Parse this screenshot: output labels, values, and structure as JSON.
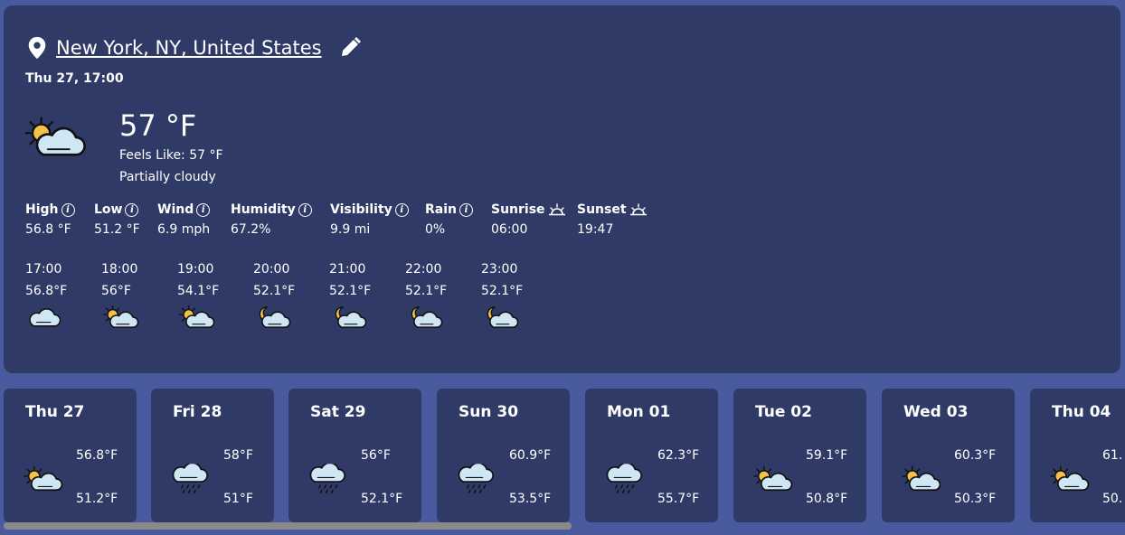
{
  "location": {
    "name": "New York, NY, United States"
  },
  "datetime": "Thu 27, 17:00",
  "current": {
    "temperature": "57 °F",
    "feels_like": "Feels Like: 57 °F",
    "condition": "Partially cloudy",
    "icon": "partly-cloudy-day-icon"
  },
  "stats": [
    {
      "label": "High",
      "value": "56.8 °F",
      "icon": "info-icon"
    },
    {
      "label": "Low",
      "value": "51.2 °F",
      "icon": "info-icon"
    },
    {
      "label": "Wind",
      "value": "6.9 mph",
      "icon": "info-icon"
    },
    {
      "label": "Humidity",
      "value": "67.2%",
      "icon": "info-icon"
    },
    {
      "label": "Visibility",
      "value": "9.9 mi",
      "icon": "info-icon"
    },
    {
      "label": "Rain",
      "value": "0%",
      "icon": "info-icon"
    },
    {
      "label": "Sunrise",
      "value": "06:00",
      "icon": "sunrise-icon"
    },
    {
      "label": "Sunset",
      "value": "19:47",
      "icon": "sunset-icon"
    }
  ],
  "hourly": [
    {
      "time": "17:00",
      "temp": "56.8°F",
      "icon": "cloudy-icon"
    },
    {
      "time": "18:00",
      "temp": "56°F",
      "icon": "partly-cloudy-day-icon"
    },
    {
      "time": "19:00",
      "temp": "54.1°F",
      "icon": "partly-cloudy-day-icon"
    },
    {
      "time": "20:00",
      "temp": "52.1°F",
      "icon": "partly-cloudy-night-icon"
    },
    {
      "time": "21:00",
      "temp": "52.1°F",
      "icon": "partly-cloudy-night-icon"
    },
    {
      "time": "22:00",
      "temp": "52.1°F",
      "icon": "partly-cloudy-night-icon"
    },
    {
      "time": "23:00",
      "temp": "52.1°F",
      "icon": "partly-cloudy-night-icon"
    }
  ],
  "daily": [
    {
      "day": "Thu 27",
      "high": "56.8°F",
      "low": "51.2°F",
      "icon": "partly-cloudy-day-icon"
    },
    {
      "day": "Fri 28",
      "high": "58°F",
      "low": "51°F",
      "icon": "rain-icon"
    },
    {
      "day": "Sat 29",
      "high": "56°F",
      "low": "52.1°F",
      "icon": "rain-icon"
    },
    {
      "day": "Sun 30",
      "high": "60.9°F",
      "low": "53.5°F",
      "icon": "rain-icon"
    },
    {
      "day": "Mon 01",
      "high": "62.3°F",
      "low": "55.7°F",
      "icon": "rain-icon"
    },
    {
      "day": "Tue 02",
      "high": "59.1°F",
      "low": "50.8°F",
      "icon": "partly-cloudy-day-icon"
    },
    {
      "day": "Wed 03",
      "high": "60.3°F",
      "low": "50.3°F",
      "icon": "partly-cloudy-day-icon"
    },
    {
      "day": "Thu 04",
      "high": "61.",
      "low": "50.",
      "icon": "partly-cloudy-day-icon"
    }
  ],
  "colors": {
    "page_bg": "#4a5a9f",
    "panel_bg": "#2f3b66",
    "sun": "#f5c04a",
    "cloud": "#cfe6f5"
  }
}
